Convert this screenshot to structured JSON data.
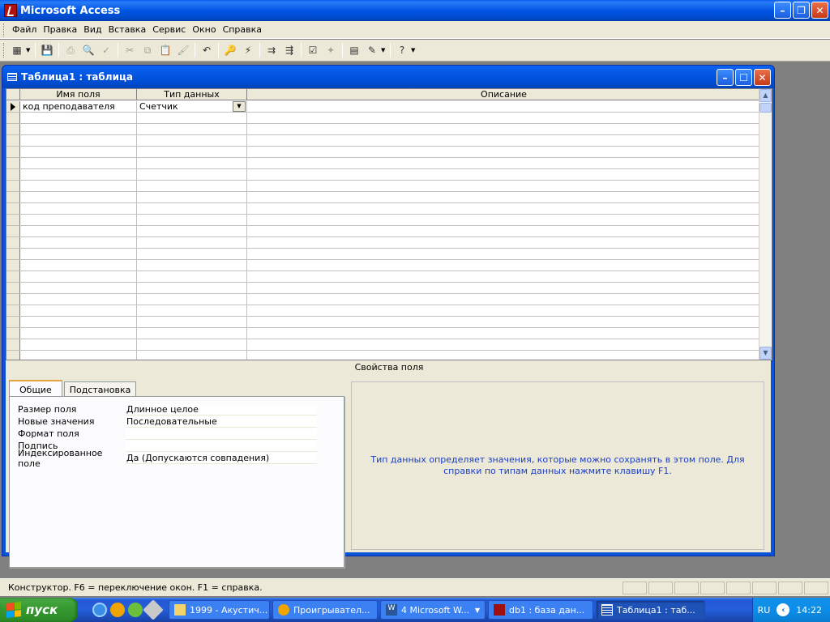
{
  "app": {
    "title": "Microsoft Access"
  },
  "menu": [
    "Файл",
    "Правка",
    "Вид",
    "Вставка",
    "Сервис",
    "Окно",
    "Справка"
  ],
  "toolbar": {
    "buttons": [
      "view-icon",
      "save-icon",
      "print-icon",
      "print-preview-icon",
      "spelling-icon",
      "cut-icon",
      "copy-icon",
      "paste-icon",
      "format-painter-icon",
      "undo-icon",
      "primary-key-icon",
      "indexes-icon",
      "insert-rows-icon",
      "delete-rows-icon",
      "properties-icon",
      "build-icon",
      "database-window-icon",
      "new-object-icon",
      "help-icon"
    ]
  },
  "child_window": {
    "title": "Таблица1 : таблица",
    "columns": [
      "Имя поля",
      "Тип данных",
      "Описание"
    ],
    "rows": [
      {
        "field": "код преподавателя",
        "type": "Счетчик",
        "description": ""
      }
    ],
    "properties_label": "Свойства поля",
    "tabs": [
      "Общие",
      "Подстановка"
    ],
    "properties": [
      {
        "label": "Размер поля",
        "value": "Длинное целое"
      },
      {
        "label": "Новые значения",
        "value": "Последовательные"
      },
      {
        "label": "Формат поля",
        "value": ""
      },
      {
        "label": "Подпись",
        "value": ""
      },
      {
        "label": "Индексированное поле",
        "value": "Да (Допускаются совпадения)"
      }
    ],
    "help_text": "Тип данных определяет значения, которые можно сохранять в этом поле.  Для справки по типам данных нажмите клавишу F1."
  },
  "status": {
    "text": "Конструктор.  F6 = переключение окон.  F1 = справка."
  },
  "taskbar": {
    "start_label": "пуск",
    "tasks": [
      {
        "label": "1999 - Акустич...",
        "icon": "folder-icon"
      },
      {
        "label": "Проигрывател...",
        "icon": "media-player-icon"
      },
      {
        "label": "4 Microsoft W...",
        "icon": "word-icon"
      },
      {
        "label": "db1 : база дан...",
        "icon": "access-db-icon"
      },
      {
        "label": "Таблица1 : таб...",
        "icon": "table-icon"
      }
    ],
    "lang": "RU",
    "clock": "14:22"
  },
  "colors": {
    "xp_blue": "#0054e3",
    "help_text": "#1a3ec2",
    "face": "#ece9d8"
  }
}
